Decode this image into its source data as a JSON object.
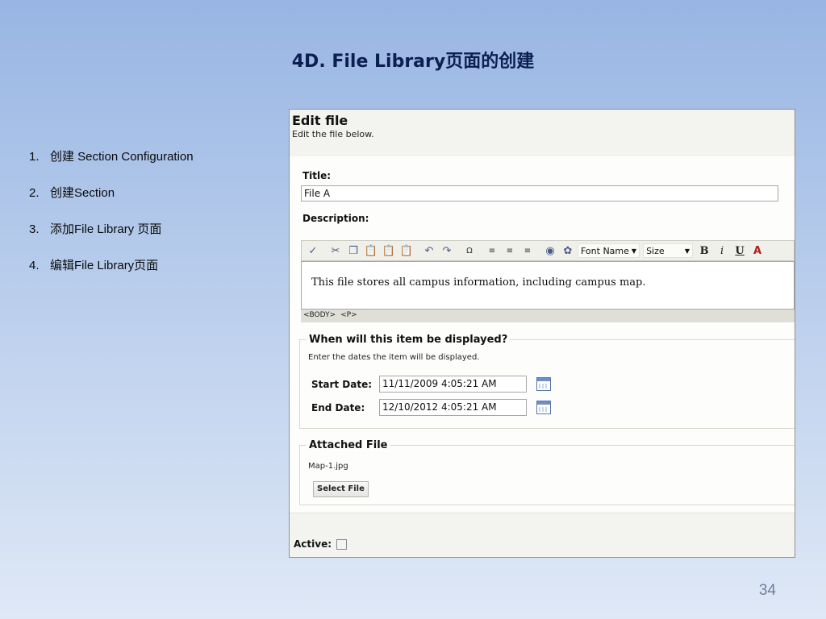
{
  "slide": {
    "title": "4D. File Library页面的创建",
    "page_number": "34",
    "steps": [
      {
        "num": "1.",
        "text": "创建 Section Configuration"
      },
      {
        "num": "2.",
        "text": "创建Section"
      },
      {
        "num": "3.",
        "text": "添加File Library 页面"
      },
      {
        "num": "4.",
        "text": "编辑File Library页面"
      }
    ]
  },
  "edit_file": {
    "heading": "Edit file",
    "subheading": "Edit the file below.",
    "title_label": "Title:",
    "title_value": "File A",
    "description_label": "Description:",
    "toolbar": {
      "font_name": "Font Name",
      "size": "Size",
      "bold": "B",
      "italic": "i",
      "underline": "U",
      "font_color": "A"
    },
    "editor_text": "This file stores all campus information, including campus map.",
    "tags": [
      "<BODY>",
      "<P>"
    ],
    "display": {
      "legend": "When will this item be displayed?",
      "description": "Enter the dates the item will be displayed.",
      "start_label": "Start Date:",
      "start_value": "11/11/2009 4:05:21 AM",
      "end_label": "End Date:",
      "end_value": "12/10/2012 4:05:21 AM"
    },
    "attached": {
      "legend": "Attached File",
      "file_name": "Map-1.jpg",
      "select_button": "Select File"
    },
    "active_label": "Active:"
  }
}
